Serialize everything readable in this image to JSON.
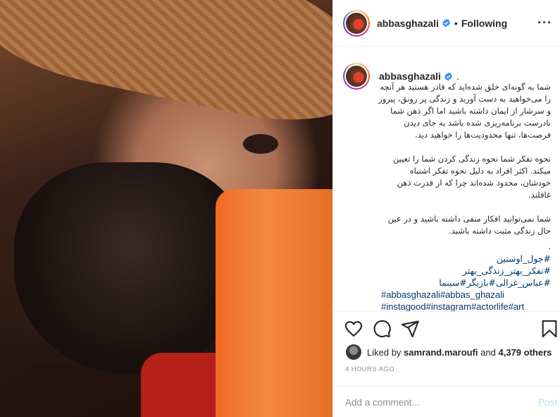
{
  "post": {
    "username": "abbasghazali",
    "follow_status": "Following",
    "separator": "•",
    "more_label": "···"
  },
  "caption": {
    "username": "abbasghazali",
    "trailing": ".",
    "paragraphs": [
      "شما به گونه‌ای خلق شده‌اید که قادر هستید هر آنچه را می‌خواهید به دست آورید و زندگی پر رونق، پیروز و سرشار از ایمان داشته باشید اما اگر ذهن شما نادرست برنامه‌ریزی شده باشد به جای دیدن فرصت‌ها، تنها محدودیت‌ها را خواهید دید.",
      "نحوه تفکر شما نحوه زندگی کردن شما را تعیین میکند. اکثر افراد به دلیل نحوه تفکر اشتباه خودشان، محدود شده‌اند چرا که از قدرت ذهن غافلند.",
      "شما نمی‌توانید افکار منفی داشته باشید و در عین حال زندگی مثبت داشته باشید."
    ],
    "dot_line": ".",
    "hashtags_fa": [
      "#جول_اوستین",
      "#تفکر_بهتر_زندگی_بهتر",
      "#عباس_غزالی#بازیگر#سینما"
    ],
    "hashtags_en": [
      "#abbasghazali#abbas_ghazali",
      "#instagood#instagram#actorlife#art"
    ]
  },
  "likes": {
    "prefix": "Liked by",
    "user": "samrand.maroufi",
    "middle": "and",
    "others": "4,379 others"
  },
  "timestamp": "4 HOURS AGO",
  "comment": {
    "placeholder": "Add a comment...",
    "post_label": "Post"
  },
  "colors": {
    "verified": "#3897f0",
    "hashtag": "#00376b",
    "post_disabled": "#b2dffc",
    "phone_orange": "#f07a2e"
  },
  "icons": [
    "verified-badge-icon",
    "heart-icon",
    "comment-icon",
    "share-icon",
    "bookmark-icon",
    "more-options-icon"
  ]
}
